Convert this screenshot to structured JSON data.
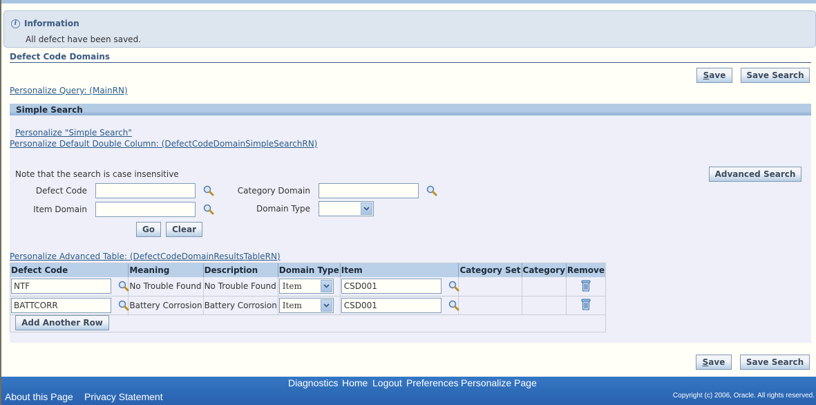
{
  "info": {
    "title": "Information",
    "message": "All defect have been saved."
  },
  "page": {
    "title": "Defect Code Domains",
    "save_label": "Save",
    "save_accesskey": "S",
    "save_rest": "ave",
    "save_search_label": "Save Search",
    "personalize_query": "Personalize Query: (MainRN)"
  },
  "simple_search": {
    "header": "Simple Search",
    "personalize_link": "Personalize \"Simple Search\"",
    "personalize_double_column": "Personalize Default Double Column: (DefectCodeDomainSimpleSearchRN)",
    "note": "Note that the search is case insensitive",
    "advanced_search_label": "Advanced Search",
    "fields": {
      "defect_code": {
        "label": "Defect Code",
        "value": ""
      },
      "item_domain": {
        "label": "Item Domain",
        "value": ""
      },
      "category_domain": {
        "label": "Category Domain",
        "value": ""
      },
      "domain_type": {
        "label": "Domain Type",
        "value": ""
      }
    },
    "go_label": "Go",
    "clear_label": "Clear"
  },
  "results": {
    "personalize_link": "Personalize Advanced Table: (DefectCodeDomainResultsTableRN)",
    "columns": [
      "Defect Code",
      "Meaning",
      "Description",
      "Domain Type",
      "Item",
      "Category Set",
      "Category",
      "Remove"
    ],
    "rows": [
      {
        "defect_code": "NTF",
        "meaning": "No Trouble Found",
        "description": "No Trouble Found",
        "domain_type": "Item",
        "item": "CSD001",
        "category_set": "",
        "category": ""
      },
      {
        "defect_code": "BATTCORR",
        "meaning": "Battery Corrosion",
        "description": "Battery Corrosion",
        "domain_type": "Item",
        "item": "CSD001",
        "category_set": "",
        "category": ""
      }
    ],
    "add_row_label": "Add Another Row"
  },
  "footer": {
    "links": [
      "Diagnostics",
      "Home",
      "Logout",
      "Preferences",
      "Personalize Page"
    ],
    "about": "About this Page",
    "privacy": "Privacy Statement",
    "copyright": "Copyright (c) 2006, Oracle. All rights reserved."
  }
}
